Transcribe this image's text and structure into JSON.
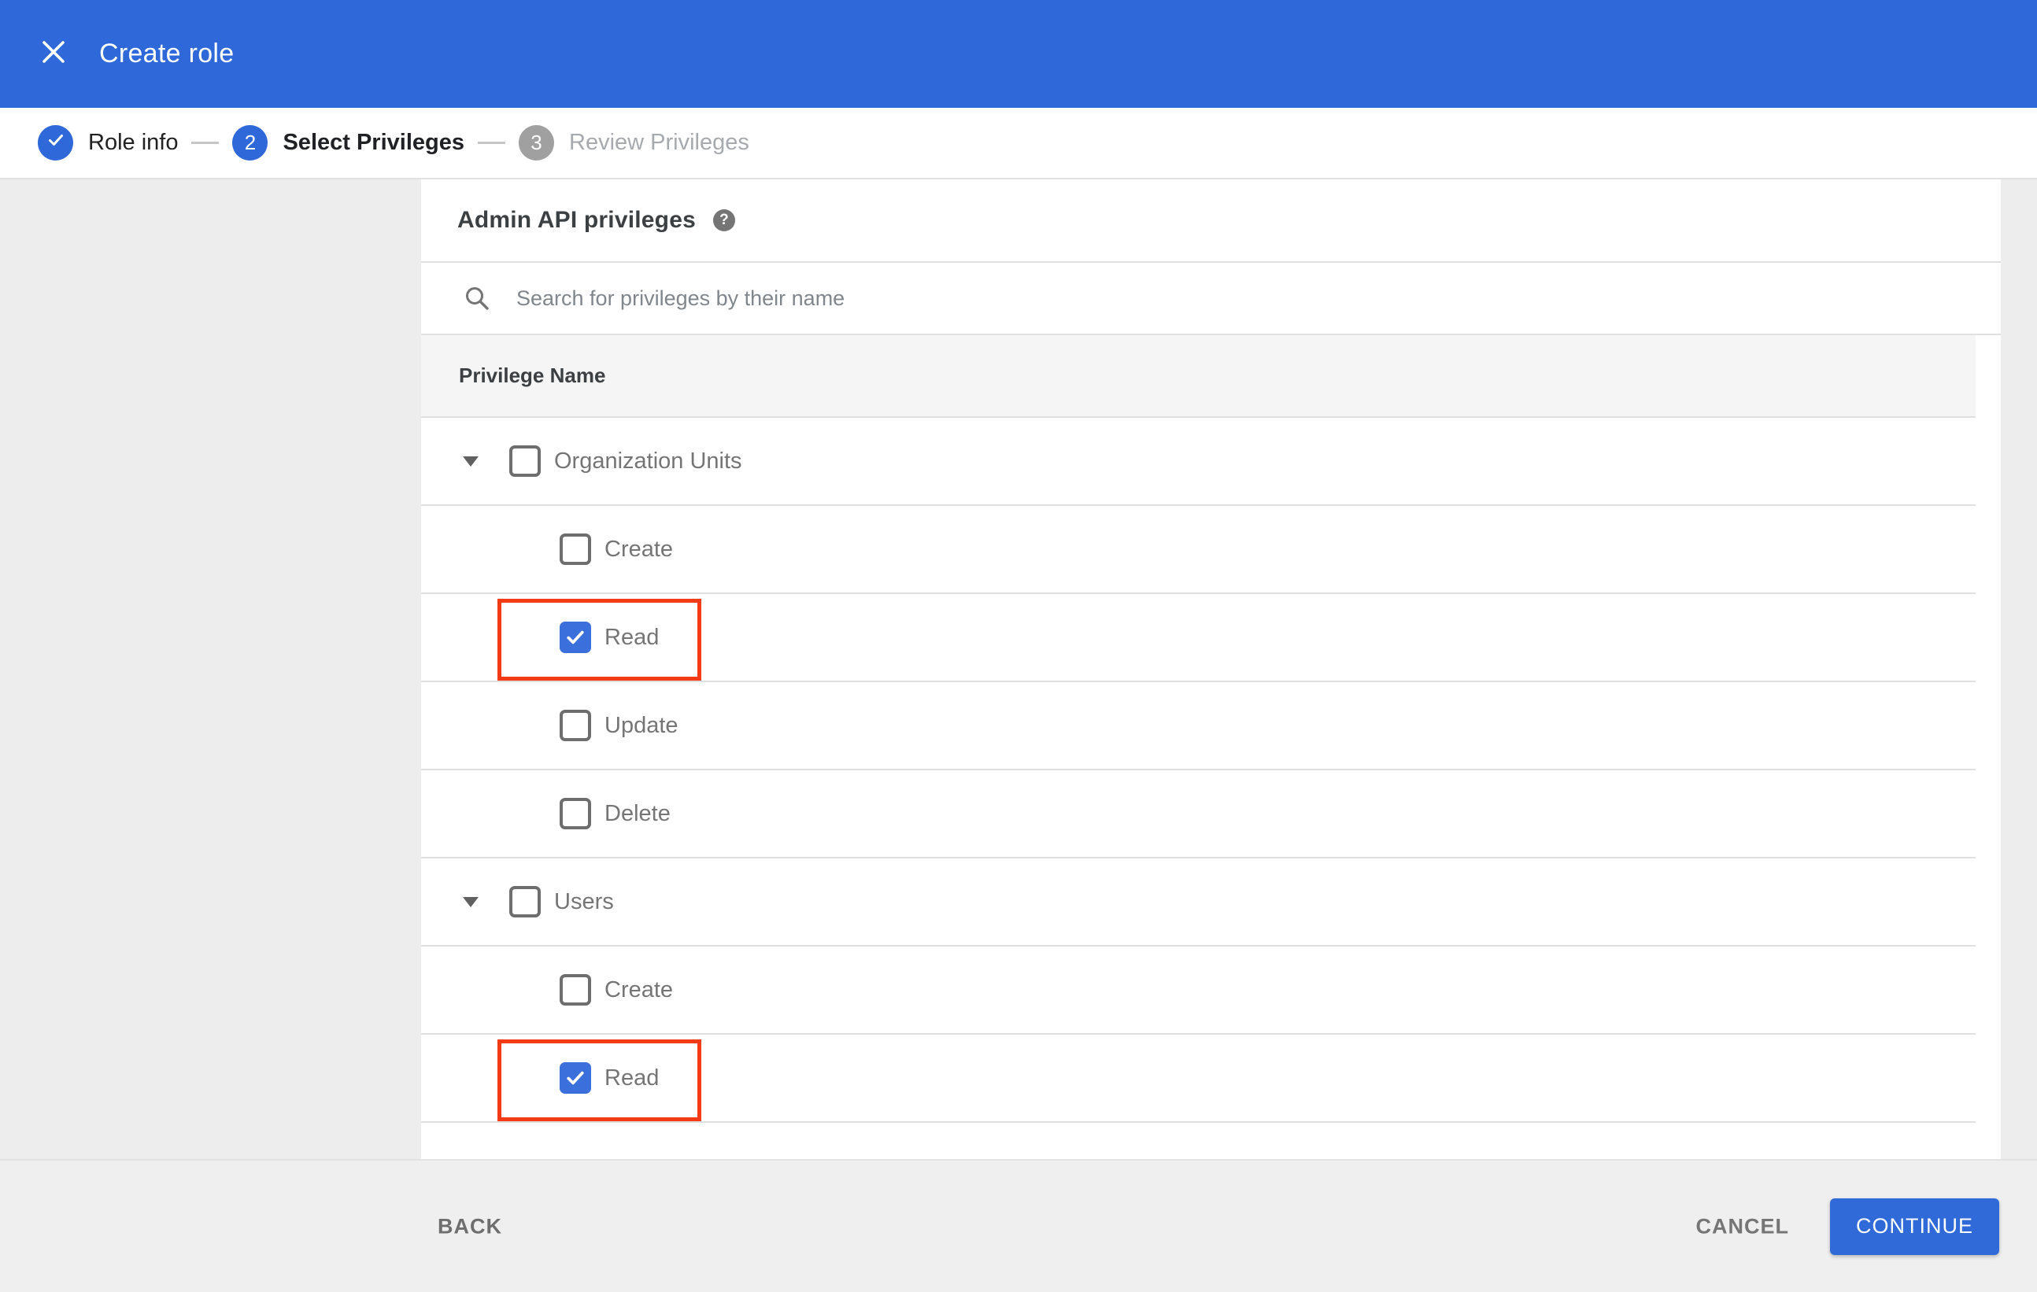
{
  "app_bar": {
    "title": "Create role",
    "close_icon": "close-x"
  },
  "stepper": {
    "steps": [
      {
        "number": "1",
        "label": "Role info",
        "state": "completed",
        "icon": "check-icon"
      },
      {
        "number": "2",
        "label": "Select Privileges",
        "state": "active"
      },
      {
        "number": "3",
        "label": "Review Privileges",
        "state": "upcoming"
      }
    ]
  },
  "content": {
    "heading": "Admin API privileges",
    "help_icon": "?",
    "search": {
      "placeholder": "Search for privileges by their name",
      "value": "",
      "icon": "search-magnifier"
    },
    "table": {
      "header": "Privilege Name",
      "rows": [
        {
          "label": "Organization Units",
          "level": "parent",
          "expanded": true,
          "checked": false,
          "highlighted": false
        },
        {
          "label": "Create",
          "level": "child",
          "checked": false,
          "highlighted": false
        },
        {
          "label": "Read",
          "level": "child",
          "checked": true,
          "highlighted": true
        },
        {
          "label": "Update",
          "level": "child",
          "checked": false,
          "highlighted": false
        },
        {
          "label": "Delete",
          "level": "child",
          "checked": false,
          "highlighted": false
        },
        {
          "label": "Users",
          "level": "parent",
          "expanded": true,
          "checked": false,
          "highlighted": false
        },
        {
          "label": "Create",
          "level": "child",
          "checked": false,
          "highlighted": false
        },
        {
          "label": "Read",
          "level": "child",
          "checked": true,
          "highlighted": true
        }
      ]
    }
  },
  "footer": {
    "back_label": "BACK",
    "cancel_label": "CANCEL",
    "continue_label": "CONTINUE"
  },
  "colors": {
    "app_bar_blue": "#2e68d9",
    "step_active_blue": "#2e68d9",
    "step_inactive_gray": "#a0a0a0",
    "checkbox_checked_blue": "#3b6fdb",
    "continue_button_blue": "#2f6ad8",
    "annotation_red": "#f33b16",
    "page_background": "#ededed",
    "table_header_background": "#f5f5f5",
    "row_border": "#e0e0e0",
    "label_gray": "#757575"
  }
}
